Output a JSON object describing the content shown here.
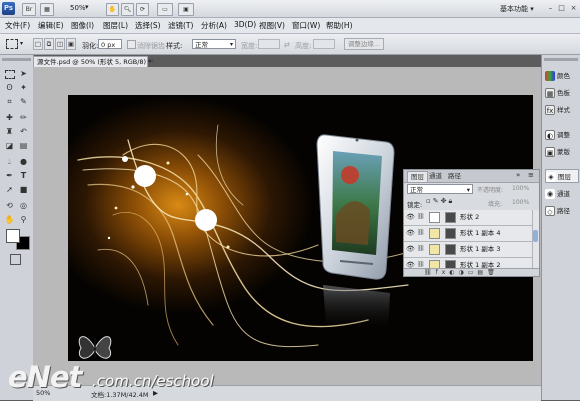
{
  "app": {
    "logo": "Ps",
    "zoom": "50%",
    "workspace": "基本功能",
    "workspace_arrow": "▾",
    "window_controls": [
      "–",
      "□",
      "×"
    ]
  },
  "menu": [
    "文件(F)",
    "编辑(E)",
    "图像(I)",
    "图层(L)",
    "选择(S)",
    "滤镜(T)",
    "分析(A)",
    "3D(D)",
    "视图(V)",
    "窗口(W)",
    "帮助(H)"
  ],
  "options": {
    "feather_label": "羽化:",
    "feather_value": "0 px",
    "antialias_label": "消除锯齿",
    "style_label": "样式:",
    "style_value": "正常",
    "width_label": "宽度:",
    "height_label": "高度:",
    "refine_button": "调整边缘..."
  },
  "document": {
    "tab_title": "源文件.psd @ 50% (形状 5, RGB/8) *",
    "tab_close": "×"
  },
  "layers_panel": {
    "tabs": [
      "图层",
      "通道",
      "路径"
    ],
    "blend_mode": "正常",
    "opacity_label": "不透明度:",
    "opacity_value": "100%",
    "lock_label": "锁定:",
    "fill_label": "填充:",
    "fill_value": "100%",
    "layers": [
      {
        "name": "形状 2",
        "visible": true
      },
      {
        "name": "形状 1 副本 4",
        "visible": true
      },
      {
        "name": "形状 1 副本 3",
        "visible": true
      },
      {
        "name": "形状 1 副本 2",
        "visible": true
      }
    ]
  },
  "right_panel": [
    {
      "label": "颜色",
      "icon": "color-icon"
    },
    {
      "label": "色板",
      "icon": "swatches-icon"
    },
    {
      "label": "样式",
      "icon": "styles-icon"
    },
    {
      "label": "调整",
      "icon": "adjustments-icon"
    },
    {
      "label": "蒙版",
      "icon": "masks-icon"
    },
    {
      "label": "图层",
      "icon": "layers-icon"
    },
    {
      "label": "通道",
      "icon": "channels-icon"
    },
    {
      "label": "路径",
      "icon": "paths-icon"
    }
  ],
  "status": {
    "zoom": "50%",
    "doc_info": "文档:1.37M/42.4M"
  },
  "watermark": {
    "brand": "eNet",
    "url": ".com.cn/eschool"
  },
  "colors": {
    "accent": "#1d3f86",
    "canvas_glow": "#d98a14",
    "canvas_bg": "#0c0804"
  }
}
